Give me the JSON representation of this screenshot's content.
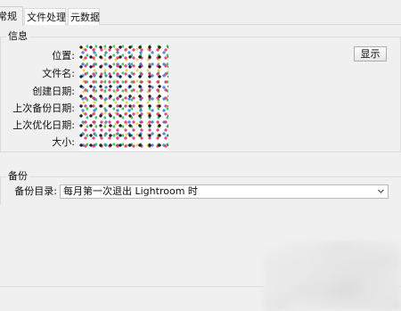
{
  "tabs": [
    {
      "label": "常规",
      "active": true
    },
    {
      "label": "文件处理",
      "active": false
    },
    {
      "label": "元数据",
      "active": false
    }
  ],
  "info": {
    "title": "信息",
    "fields": [
      {
        "label": "位置:"
      },
      {
        "label": "文件名:"
      },
      {
        "label": "创建日期:"
      },
      {
        "label": "上次备份日期:"
      },
      {
        "label": "上次优化日期:"
      },
      {
        "label": "大小:"
      }
    ],
    "show_button": "显示"
  },
  "backup": {
    "title": "备份",
    "directory_label": "备份目录:",
    "directory_value": "每月第一次退出 Lightroom 时"
  },
  "colors": {
    "window_bg": "#f0f0f0",
    "border": "#dcdcdc",
    "field_bg": "#ffffff"
  },
  "icons": {
    "dropdown": "chevron-down-icon"
  }
}
